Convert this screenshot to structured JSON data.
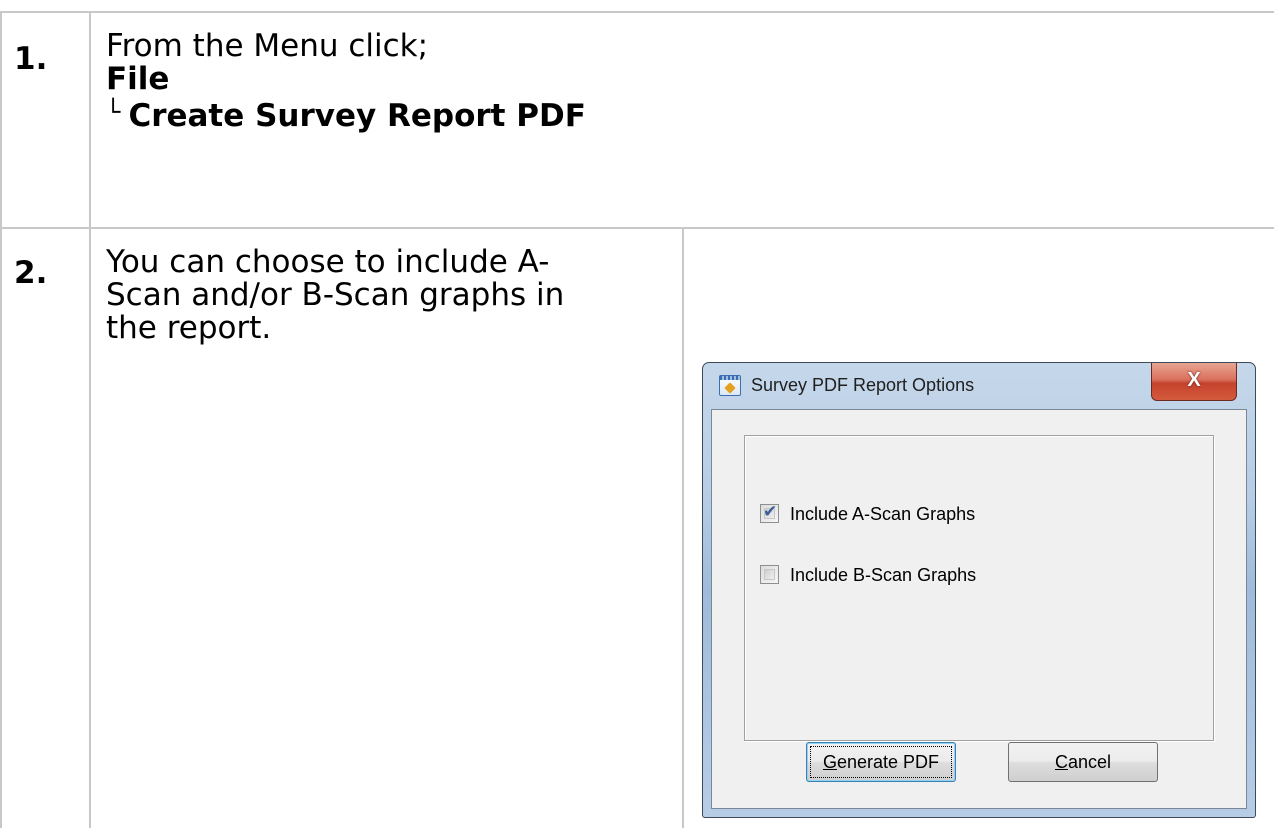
{
  "steps": [
    {
      "number": "1.",
      "line1": "From the Menu click;",
      "menu": "File",
      "submenu_marker": "└",
      "submenu": "Create Survey Report PDF"
    },
    {
      "number": "2.",
      "text": "You can choose to include A-Scan and/or B-Scan graphs in the report.",
      "text_lines": [
        "You can choose to include A-",
        "Scan and/or B-Scan graphs in",
        "the report."
      ]
    }
  ],
  "dialog": {
    "title": "Survey PDF Report Options",
    "close_glyph": "X",
    "options": [
      {
        "label": "Include A-Scan Graphs",
        "checked": true
      },
      {
        "label": "Include B-Scan Graphs",
        "checked": false
      }
    ],
    "buttons": {
      "generate": {
        "accel": "G",
        "rest": "enerate PDF"
      },
      "cancel": {
        "accel": "C",
        "rest": "ancel"
      }
    },
    "icons": {
      "app": "app-icon",
      "close": "close-icon",
      "check": "checkmark-icon"
    }
  }
}
